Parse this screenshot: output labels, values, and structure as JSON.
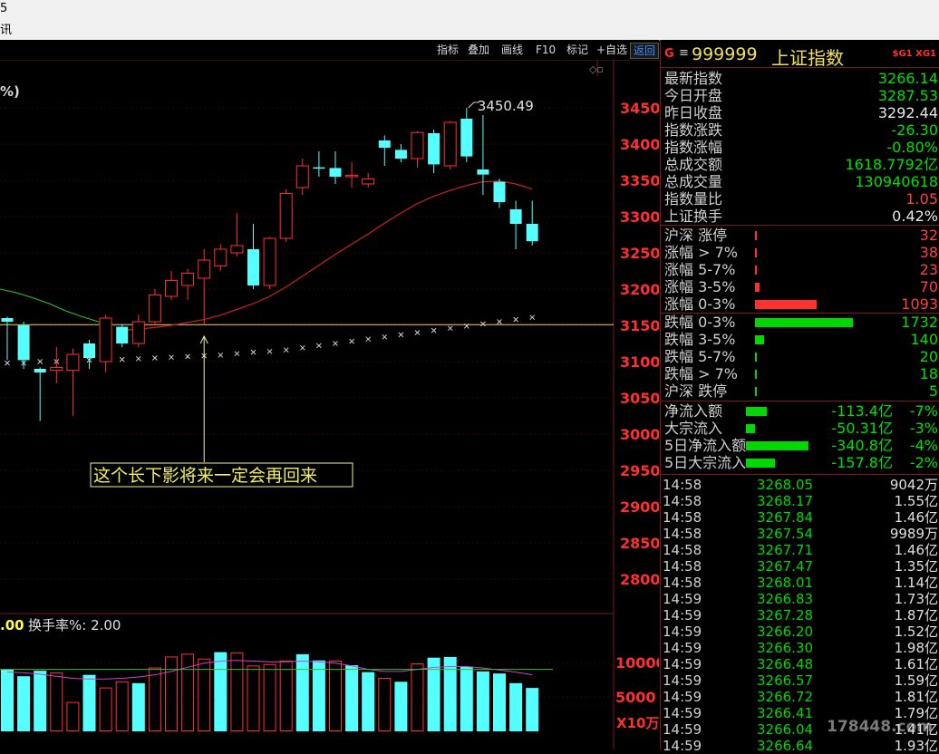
{
  "topbar": {
    "fragments": [
      "5",
      "讯"
    ]
  },
  "toolbar": {
    "buttons": [
      "指标",
      "叠加",
      "画线",
      "F10",
      "标记",
      "+自选",
      "返回"
    ],
    "active": "返回"
  },
  "chart_labels": {
    "corner": "%)",
    "annotation": "这个长下影将来一定会再回来",
    "high_label": "3450.49",
    "turnover_value": ".00",
    "turnover_label": "换手率%: 2.00",
    "vol_unit": "X10万"
  },
  "chart_data": {
    "type": "candlestick",
    "y_ticks": [
      3450,
      3400,
      3350,
      3300,
      3250,
      3200,
      3150,
      3100,
      3050,
      3000,
      2950,
      2900,
      2850,
      2800
    ],
    "ylim": [
      2770,
      3490
    ],
    "horizontal_line": 3151,
    "candles": [
      {
        "o": 3160,
        "c": 3155,
        "h": 3162,
        "l": 3102
      },
      {
        "o": 3150,
        "c": 3102,
        "h": 3155,
        "l": 3090
      },
      {
        "o": 3090,
        "c": 3085,
        "h": 3092,
        "l": 3018
      },
      {
        "o": 3088,
        "c": 3092,
        "h": 3120,
        "l": 3070
      },
      {
        "o": 3088,
        "c": 3110,
        "h": 3118,
        "l": 3025
      },
      {
        "o": 3125,
        "c": 3105,
        "h": 3130,
        "l": 3090
      },
      {
        "o": 3100,
        "c": 3160,
        "h": 3165,
        "l": 3085
      },
      {
        "o": 3148,
        "c": 3125,
        "h": 3152,
        "l": 3120
      },
      {
        "o": 3125,
        "c": 3155,
        "h": 3165,
        "l": 3120
      },
      {
        "o": 3155,
        "c": 3192,
        "h": 3200,
        "l": 3150
      },
      {
        "o": 3190,
        "c": 3212,
        "h": 3225,
        "l": 3185
      },
      {
        "o": 3205,
        "c": 3222,
        "h": 3228,
        "l": 3185
      },
      {
        "o": 3215,
        "c": 3240,
        "h": 3255,
        "l": 3151
      },
      {
        "o": 3232,
        "c": 3255,
        "h": 3262,
        "l": 3225
      },
      {
        "o": 3250,
        "c": 3260,
        "h": 3305,
        "l": 3245
      },
      {
        "o": 3255,
        "c": 3205,
        "h": 3290,
        "l": 3200
      },
      {
        "o": 3205,
        "c": 3270,
        "h": 3272,
        "l": 3200
      },
      {
        "o": 3270,
        "c": 3332,
        "h": 3338,
        "l": 3265
      },
      {
        "o": 3340,
        "c": 3370,
        "h": 3380,
        "l": 3330
      },
      {
        "o": 3368,
        "c": 3367,
        "h": 3390,
        "l": 3355
      },
      {
        "o": 3367,
        "c": 3355,
        "h": 3390,
        "l": 3345
      },
      {
        "o": 3355,
        "c": 3357,
        "h": 3375,
        "l": 3340
      },
      {
        "o": 3345,
        "c": 3352,
        "h": 3360,
        "l": 3340
      },
      {
        "o": 3405,
        "c": 3395,
        "h": 3412,
        "l": 3370
      },
      {
        "o": 3392,
        "c": 3380,
        "h": 3400,
        "l": 3375
      },
      {
        "o": 3380,
        "c": 3416,
        "h": 3418,
        "l": 3368
      },
      {
        "o": 3415,
        "c": 3372,
        "h": 3420,
        "l": 3360
      },
      {
        "o": 3370,
        "c": 3430,
        "h": 3432,
        "l": 3365
      },
      {
        "o": 3435,
        "c": 3383,
        "h": 3450,
        "l": 3375
      },
      {
        "o": 3365,
        "c": 3358,
        "h": 3440,
        "l": 3330
      },
      {
        "o": 3348,
        "c": 3320,
        "h": 3352,
        "l": 3312
      },
      {
        "o": 3310,
        "c": 3290,
        "h": 3322,
        "l": 3255
      },
      {
        "o": 3290,
        "c": 3266,
        "h": 3322,
        "l": 3260
      }
    ],
    "ma20": [
      3193,
      3175,
      3160,
      3152,
      3145,
      3142,
      3142,
      3143,
      3145,
      3147,
      3150,
      3154,
      3158,
      3164,
      3172,
      3180,
      3190,
      3203,
      3218,
      3233,
      3248,
      3262,
      3276,
      3291,
      3305,
      3318,
      3328,
      3336,
      3343,
      3348,
      3349,
      3345,
      3338
    ],
    "green_line": [
      3200,
      3195,
      3188,
      3180,
      3170,
      3162,
      3155,
      3150
    ],
    "x_markers": [
      3098,
      3098,
      3100,
      3100,
      3101,
      3102,
      3103,
      3103,
      3104,
      3105,
      3106,
      3107,
      3108,
      3109,
      3111,
      3113,
      3114,
      3116,
      3119,
      3122,
      3125,
      3128,
      3131,
      3134,
      3137,
      3140,
      3143,
      3146,
      3149,
      3152,
      3155,
      3158,
      3161
    ],
    "volume": {
      "y_ticks": [
        10000,
        5000
      ],
      "ylim": [
        0,
        12000
      ],
      "values": [
        9000,
        8000,
        8800,
        8500,
        4200,
        8200,
        6300,
        7200,
        7000,
        9200,
        10800,
        11200,
        10500,
        11500,
        11400,
        9500,
        9700,
        10200,
        11200,
        10300,
        10200,
        9600,
        8600,
        7700,
        7200,
        9800,
        10700,
        10800,
        9400,
        8700,
        8400,
        7000,
        6300
      ],
      "colors": [
        "c",
        "c",
        "c",
        "r",
        "r",
        "c",
        "r",
        "r",
        "c",
        "r",
        "r",
        "r",
        "r",
        "c",
        "r",
        "r",
        "r",
        "r",
        "c",
        "c",
        "r",
        "c",
        "c",
        "r",
        "c",
        "r",
        "c",
        "c",
        "c",
        "c",
        "c",
        "c",
        "c"
      ],
      "ma": [
        8600,
        8500,
        8300,
        8000,
        7700,
        7600,
        7600,
        7700,
        7900,
        8200,
        8700,
        9300,
        9900,
        10200,
        10300,
        10200,
        10100,
        10100,
        10200,
        10100,
        9900,
        9500,
        9000,
        8700,
        8700,
        9000,
        9300,
        9400,
        9400,
        9200,
        8900,
        8600,
        8200
      ]
    }
  },
  "panel": {
    "header": {
      "g": "G",
      "menu_icon": "menu-icon",
      "code": "999999",
      "name": "上证指数",
      "badge": "$G1 XG1"
    },
    "stats": [
      {
        "label": "最新指数",
        "value": "3266.14",
        "color": "green"
      },
      {
        "label": "今日开盘",
        "value": "3287.53",
        "color": "green"
      },
      {
        "label": "昨日收盘",
        "value": "3292.44",
        "color": "white"
      },
      {
        "label": "指数涨跌",
        "value": "-26.30",
        "color": "green"
      },
      {
        "label": "指数涨幅",
        "value": "-0.80%",
        "color": "green"
      },
      {
        "label": "总成交额",
        "value": "1618.7792亿",
        "color": "green"
      },
      {
        "label": "总成交量",
        "value": "130940618",
        "color": "green"
      },
      {
        "label": "指数量比",
        "value": "1.05",
        "color": "red"
      },
      {
        "label": "上证换手",
        "value": "0.42%",
        "color": "white"
      }
    ],
    "up_dist": [
      {
        "label": "沪深  涨停",
        "value": "32",
        "bar": 0.02
      },
      {
        "label": "涨幅 > 7%",
        "value": "38",
        "bar": 0.02
      },
      {
        "label": "涨幅 5-7%",
        "value": "23",
        "bar": 0.015
      },
      {
        "label": "涨幅 3-5%",
        "value": "70",
        "bar": 0.05
      },
      {
        "label": "涨幅 0-3%",
        "value": "1093",
        "bar": 0.63
      }
    ],
    "down_dist": [
      {
        "label": "跌幅 0-3%",
        "value": "1732",
        "bar": 1.0
      },
      {
        "label": "跌幅 3-5%",
        "value": "140",
        "bar": 0.09
      },
      {
        "label": "跌幅 5-7%",
        "value": "20",
        "bar": 0.012
      },
      {
        "label": "跌幅 > 7%",
        "value": "18",
        "bar": 0.012
      },
      {
        "label": "沪深  跌停",
        "value": "5",
        "bar": 0.004
      }
    ],
    "flows": [
      {
        "label": "净流入额",
        "value": "-113.4亿",
        "pct": "-7%",
        "bar": 0.25
      },
      {
        "label": "大宗流入",
        "value": "-50.31亿",
        "pct": "-3%",
        "bar": 0.11
      },
      {
        "label": "5日净流入额",
        "value": "-340.8亿",
        "pct": "-4%",
        "bar": 0.75
      },
      {
        "label": "5日大宗流入",
        "value": "-157.8亿",
        "pct": "-2%",
        "bar": 0.35
      }
    ],
    "ticks": [
      {
        "time": "14:58",
        "price": "3268.05",
        "vol": "9042万"
      },
      {
        "time": "14:58",
        "price": "3268.17",
        "vol": "1.55亿"
      },
      {
        "time": "14:58",
        "price": "3267.84",
        "vol": "1.46亿"
      },
      {
        "time": "14:58",
        "price": "3267.54",
        "vol": "9989万"
      },
      {
        "time": "14:58",
        "price": "3267.71",
        "vol": "1.46亿"
      },
      {
        "time": "14:58",
        "price": "3267.47",
        "vol": "1.35亿"
      },
      {
        "time": "14:58",
        "price": "3268.01",
        "vol": "1.14亿"
      },
      {
        "time": "14:59",
        "price": "3266.83",
        "vol": "1.73亿"
      },
      {
        "time": "14:59",
        "price": "3267.28",
        "vol": "1.87亿"
      },
      {
        "time": "14:59",
        "price": "3266.20",
        "vol": "1.52亿"
      },
      {
        "time": "14:59",
        "price": "3266.30",
        "vol": "1.98亿"
      },
      {
        "time": "14:59",
        "price": "3266.48",
        "vol": "1.61亿"
      },
      {
        "time": "14:59",
        "price": "3266.57",
        "vol": "1.59亿"
      },
      {
        "time": "14:59",
        "price": "3266.72",
        "vol": "1.81亿"
      },
      {
        "time": "14:59",
        "price": "3266.41",
        "vol": "1.79亿"
      },
      {
        "time": "14:59",
        "price": "3266.04",
        "vol": "1.41亿"
      },
      {
        "time": "14:59",
        "price": "3266.64",
        "vol": "1.93亿"
      }
    ],
    "watermark": "178448.com"
  }
}
